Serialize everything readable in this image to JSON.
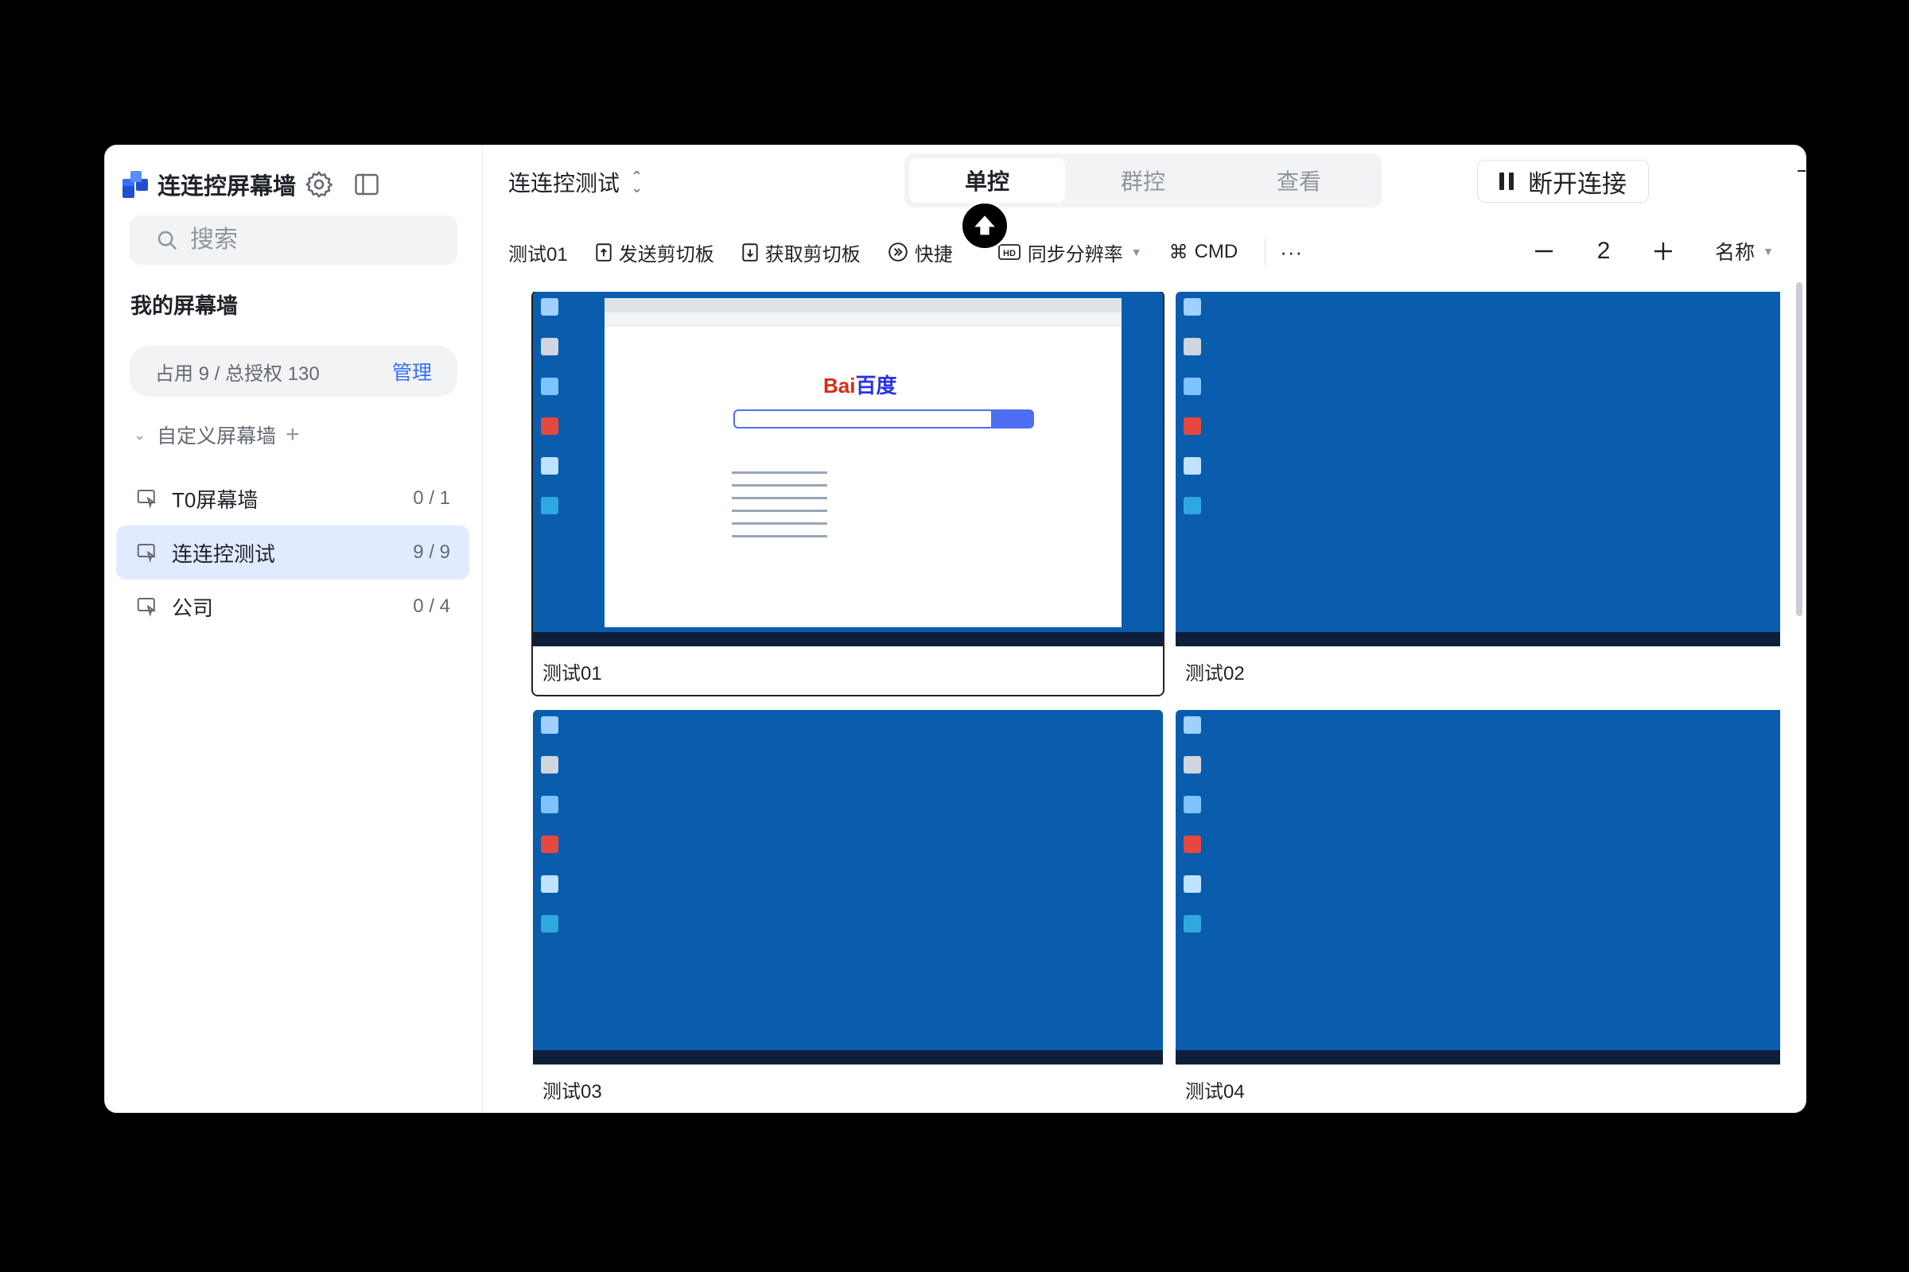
{
  "app": {
    "title": "连连控屏幕墙"
  },
  "search": {
    "placeholder": "搜索"
  },
  "sidebar": {
    "section_title": "我的屏幕墙",
    "quota": {
      "text": "占用 9 / 总授权 130",
      "manage": "管理"
    },
    "group": {
      "label": "自定义屏幕墙"
    },
    "walls": [
      {
        "name": "T0屏幕墙",
        "count": "0 / 1"
      },
      {
        "name": "连连控测试",
        "count": "9 / 9"
      },
      {
        "name": "公司",
        "count": "0 / 4"
      }
    ]
  },
  "header": {
    "current_wall": "连连控测试",
    "modes": [
      "单控",
      "群控",
      "查看"
    ],
    "disconnect": "断开连接"
  },
  "toolbar": {
    "target": "测试01",
    "send_clipboard": "发送剪切板",
    "get_clipboard": "获取剪切板",
    "shortcut": "快捷",
    "sync_resolution": "同步分辨率",
    "cmd": "CMD",
    "more": "···"
  },
  "zoom": {
    "value": "2",
    "sort_by": "名称"
  },
  "tiles": [
    {
      "label": "测试01"
    },
    {
      "label": "测试02"
    },
    {
      "label": "测试03"
    },
    {
      "label": "测试04"
    }
  ],
  "baidu": {
    "logo_left": "Bai",
    "logo_right": "百度"
  },
  "colors": {
    "accent": "#3370ff",
    "desktop": "#0a5cad",
    "active_item": "#e1eaff"
  }
}
